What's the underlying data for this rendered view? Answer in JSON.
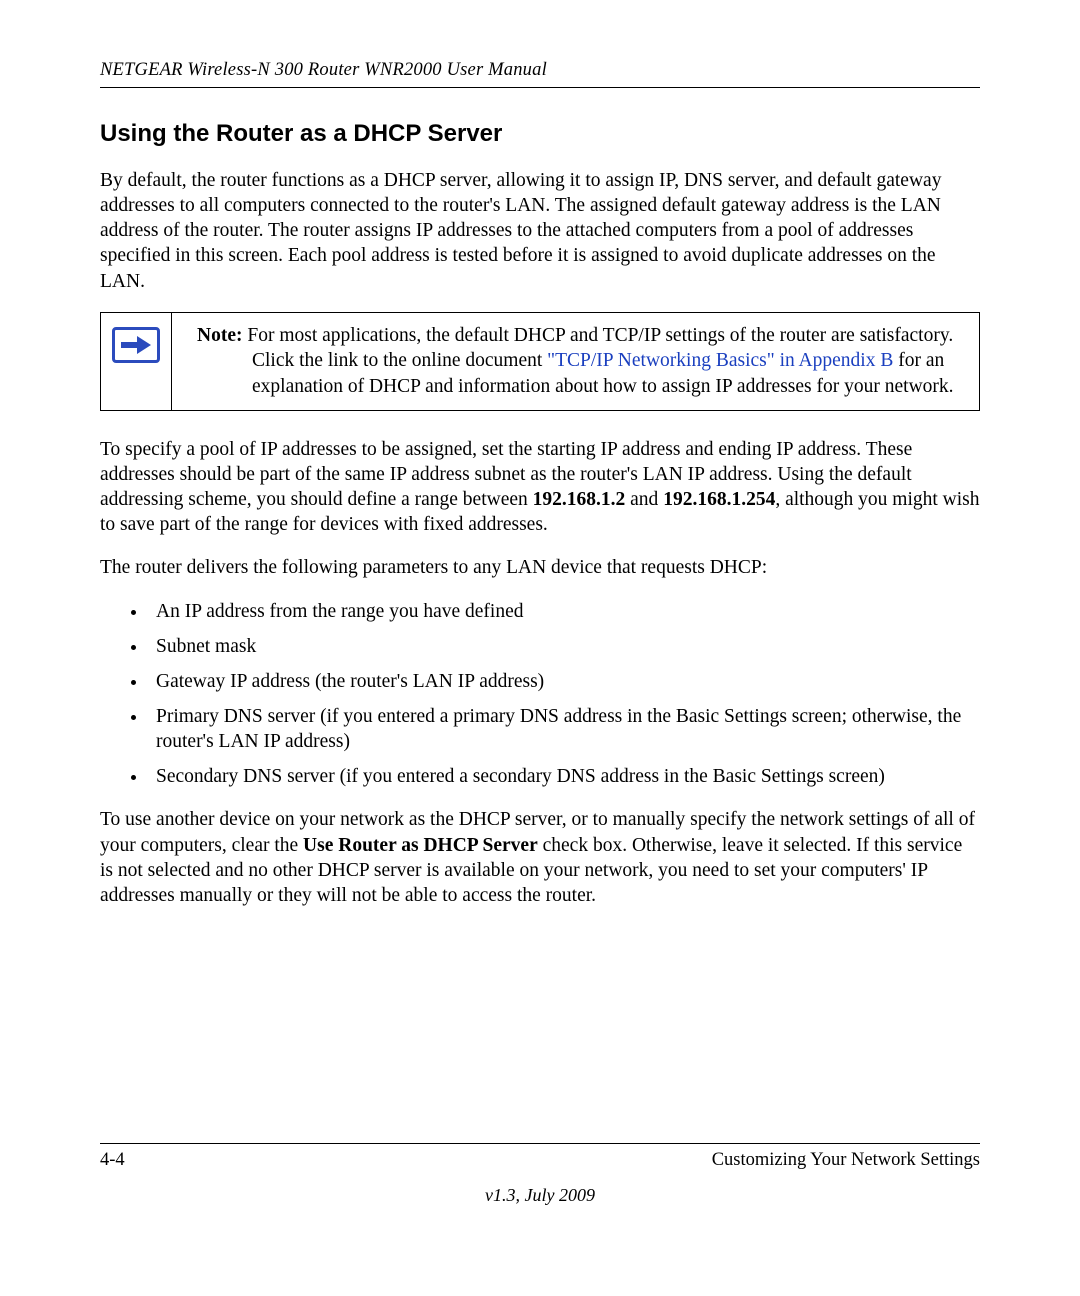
{
  "header": {
    "manual_title": "NETGEAR Wireless-N 300 Router WNR2000 User Manual"
  },
  "section": {
    "heading": "Using the Router as a DHCP Server",
    "intro": "By default, the router functions as a DHCP server, allowing it to assign IP, DNS server, and default gateway addresses to all computers connected to the router's LAN. The assigned default gateway address is the LAN address of the router. The router assigns IP addresses to the attached computers from a pool of addresses specified in this screen. Each pool address is tested before it is assigned to avoid duplicate addresses on the LAN.",
    "note": {
      "label": "Note:",
      "before_link": " For most applications, the default DHCP and TCP/IP settings of the router are satisfactory. Click the link to the online document ",
      "link_text": "\"TCP/IP Networking Basics\" in Appendix B",
      "after_link": " for an explanation of DHCP and information about how to assign IP addresses for your network."
    },
    "pool_a": "To specify a pool of IP addresses to be assigned, set the starting IP address and ending IP address. These addresses should be part of the same IP address subnet as the router's LAN IP address. Using the default addressing scheme, you should define a range between ",
    "pool_start": "192.168.1.2",
    "pool_mid": " and ",
    "pool_end": "192.168.1.254",
    "pool_b": ", although you might wish to save part of the range for devices with fixed addresses.",
    "delivers_intro": "The router delivers the following parameters to any LAN device that requests DHCP:",
    "params": [
      "An IP address from the range you have defined",
      "Subnet mask",
      "Gateway IP address (the router's LAN IP address)",
      "Primary DNS server (if you entered a primary DNS address in the Basic Settings screen; otherwise, the router's LAN IP address)",
      "Secondary DNS server (if you entered a secondary DNS address in the Basic Settings screen)"
    ],
    "other_a": "To use another device on your network as the DHCP server, or to manually specify the network settings of all of your computers, clear the ",
    "other_bold": "Use Router as DHCP Server",
    "other_b": " check box. Otherwise, leave it selected. If this service is not selected and no other DHCP server is available on your network, you need to set your computers' IP addresses manually or they will not be able to access the router."
  },
  "footer": {
    "page_num": "4-4",
    "chapter": "Customizing Your Network Settings",
    "version": "v1.3, July 2009"
  }
}
